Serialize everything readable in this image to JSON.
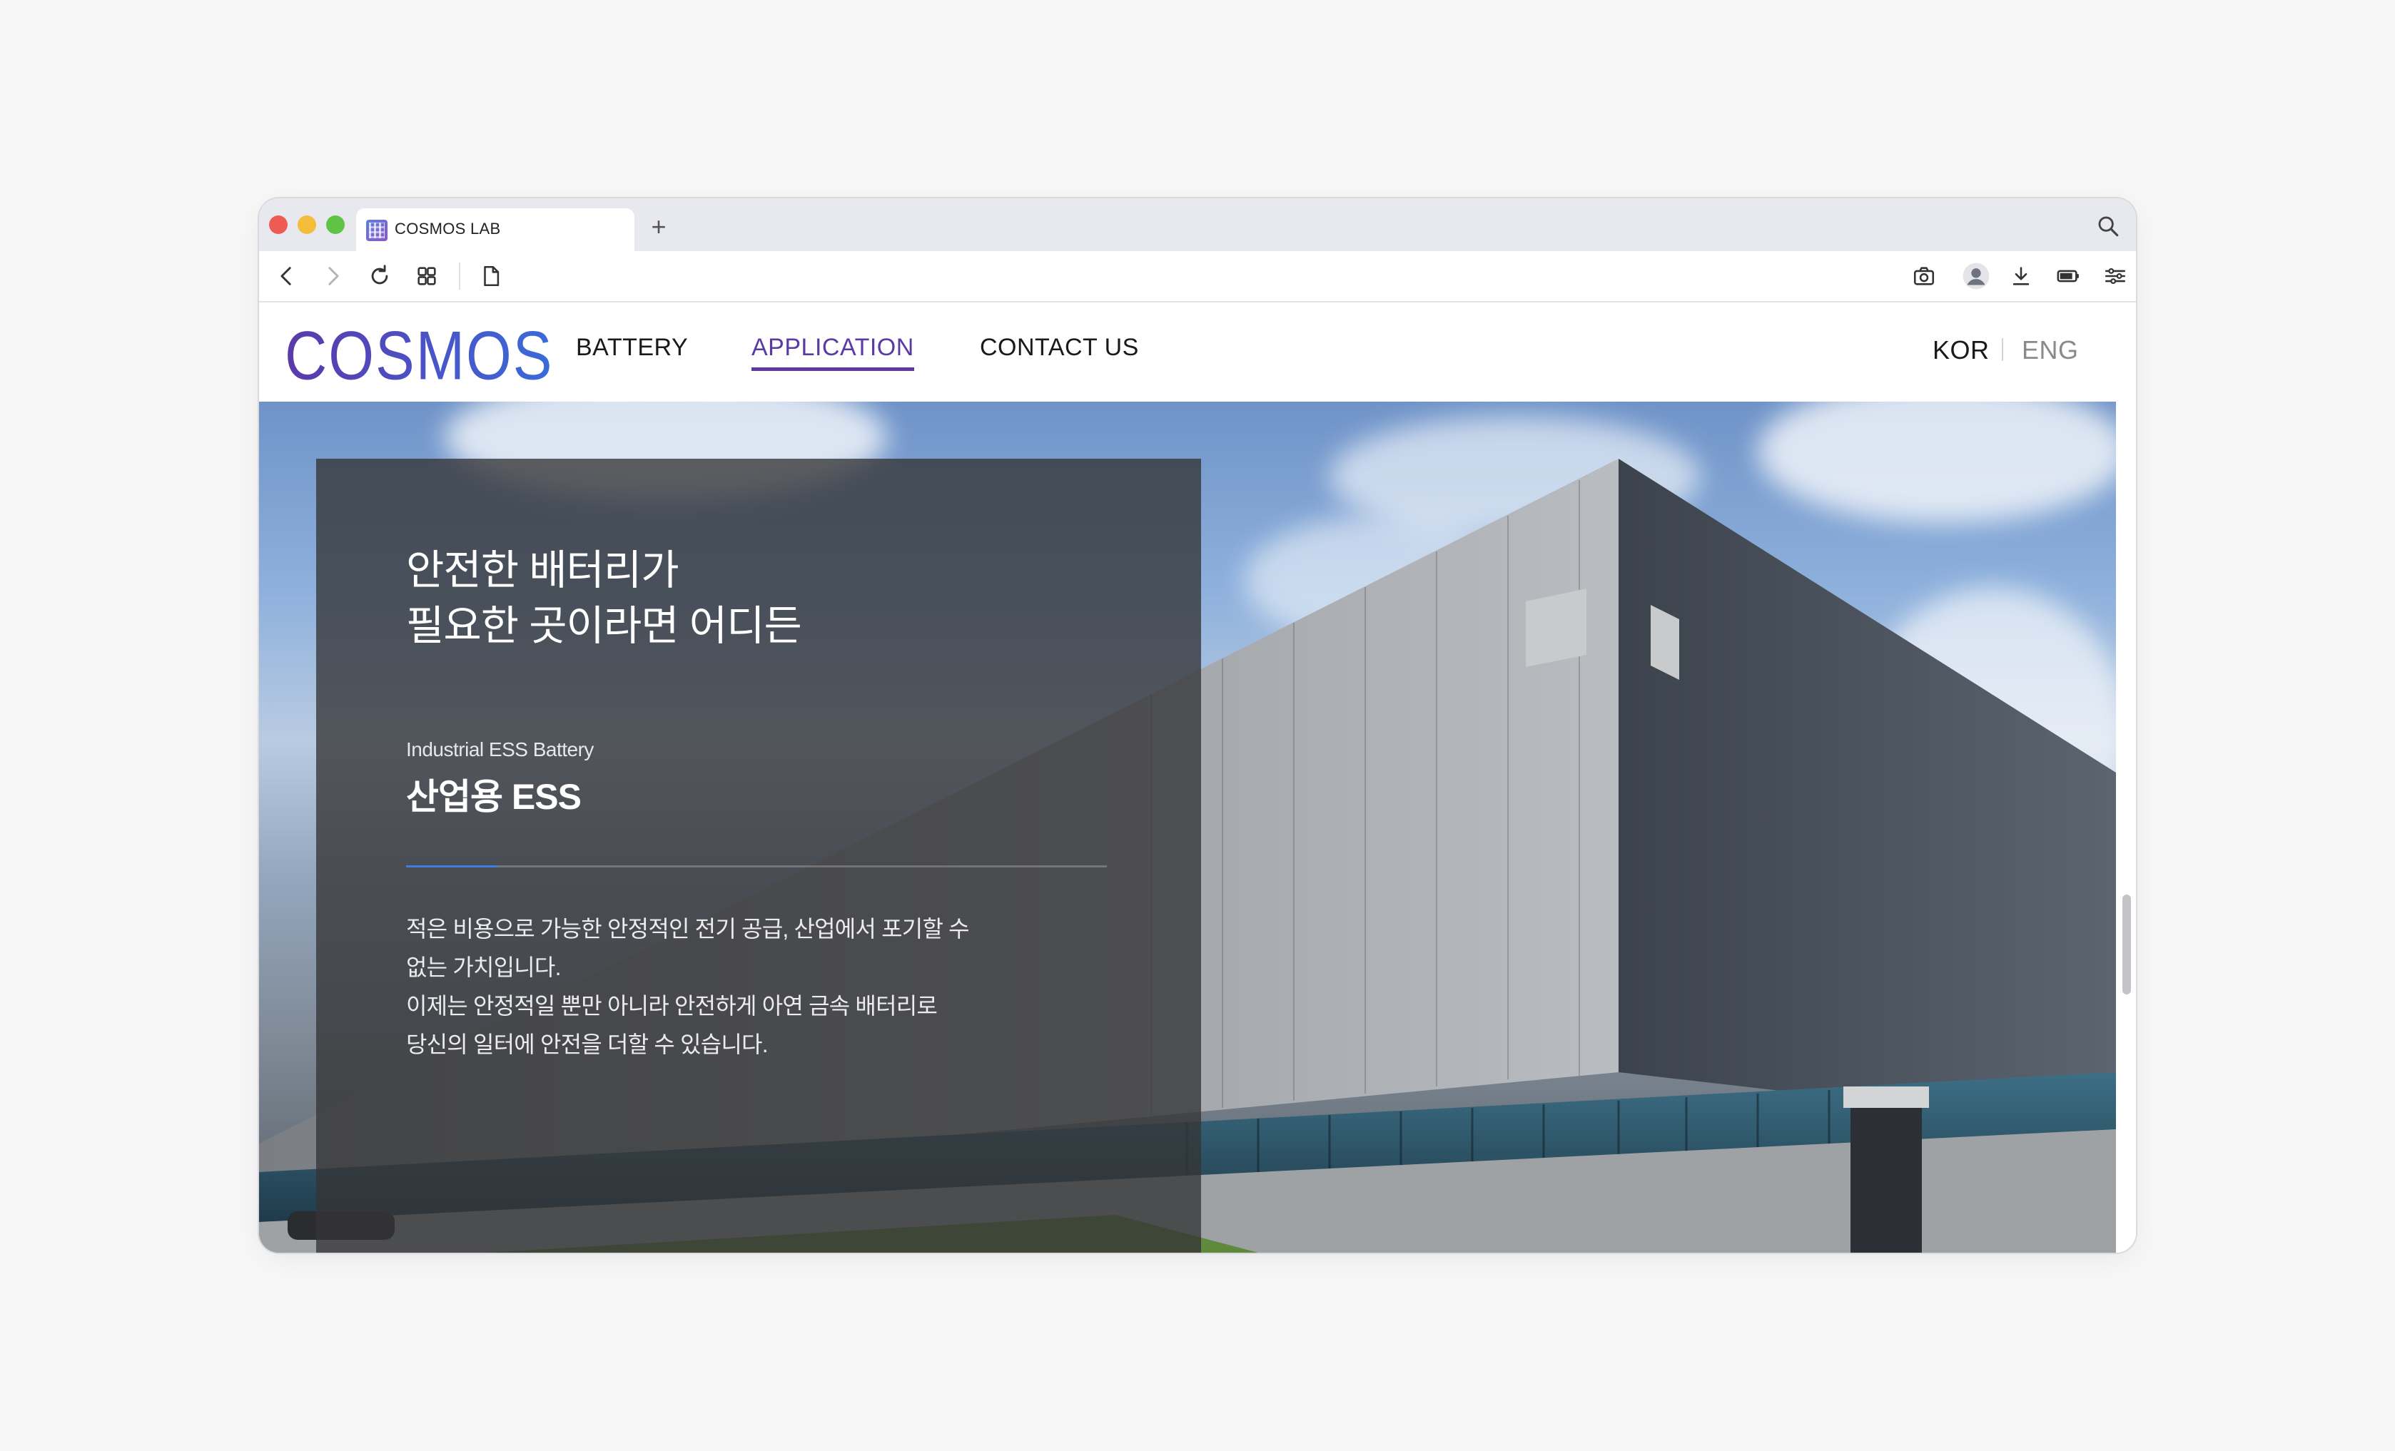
{
  "browser": {
    "tab_title": "COSMOS LAB",
    "new_tab_label": "+"
  },
  "icons": {
    "back": "chevron-left-icon",
    "forward": "chevron-right-icon",
    "reload": "reload-icon",
    "tabs_grid": "grid-icon",
    "page": "document-icon",
    "camera": "camera-icon",
    "profile": "user-avatar-icon",
    "download": "download-icon",
    "battery": "battery-icon",
    "settings": "sliders-icon",
    "search": "search-icon"
  },
  "site": {
    "logo_text": "COSMOS",
    "nav": {
      "battery": "BATTERY",
      "application": "APPLICATION",
      "contact": "CONTACT US"
    },
    "lang": {
      "kor": "KOR",
      "eng": "ENG"
    },
    "hero": {
      "headline_line1": "안전한 배터리가",
      "headline_line2": "필요한 곳이라면 어디든",
      "subtitle_en": "Industrial ESS Battery",
      "subtitle_ko": "산업용 ESS",
      "slider_progress": 0.13,
      "body_line1": "적은 비용으로 가능한 안정적인 전기 공급, 산업에서 포기할 수",
      "body_line2": "없는 가치입니다.",
      "body_line3": "이제는 안정적일 뿐만 아니라 안전하게 아연 금속 배터리로",
      "body_line4": "당신의 일터에 안전을 더할 수 있습니다."
    }
  },
  "colors": {
    "accent_purple": "#5c3aa5",
    "progress_blue": "#3c7fe0",
    "traffic_red": "#ee5b55",
    "traffic_yellow": "#f4bd3a",
    "traffic_green": "#5fc346"
  }
}
